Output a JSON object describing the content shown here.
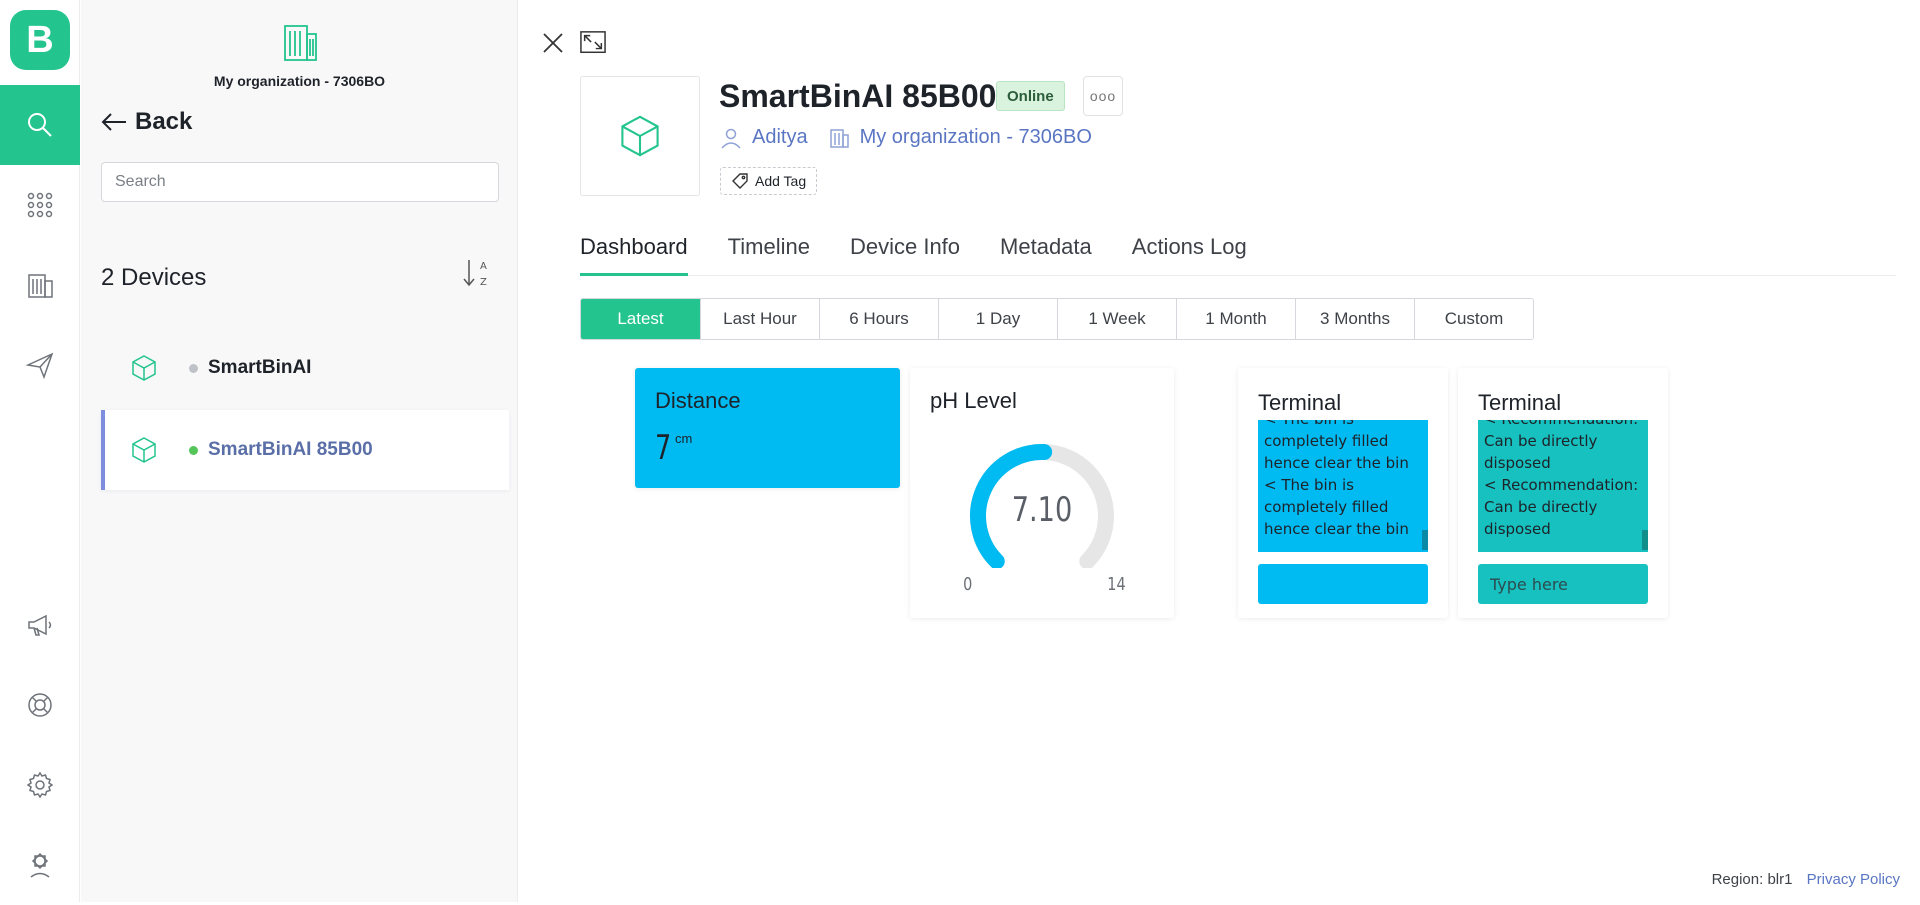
{
  "app": {
    "logo_letter": "B"
  },
  "rail": {
    "items": [
      "search-icon",
      "apps-grid-icon",
      "building-icon",
      "send-icon",
      "megaphone-icon",
      "lifebuoy-icon",
      "gear-icon",
      "user-badge-icon"
    ],
    "active": "search-icon"
  },
  "panel": {
    "org_name": "My organization - 7306BO",
    "back_label": "Back",
    "search_placeholder": "Search",
    "device_count": "2 Devices",
    "sort_icon": "sort-az-icon",
    "devices": [
      {
        "name": "SmartBinAI",
        "status": "offline",
        "status_color": "#bfc2c7"
      },
      {
        "name": "SmartBinAI 85B00",
        "status": "online",
        "status_color": "#53c559"
      }
    ]
  },
  "device": {
    "name": "SmartBinAI 85B00",
    "status_badge": "Online",
    "more_label": "ooo",
    "owner": "Aditya",
    "organization": "My organization - 7306BO",
    "add_tag_label": "Add Tag"
  },
  "tabs": [
    "Dashboard",
    "Timeline",
    "Device Info",
    "Metadata",
    "Actions Log"
  ],
  "active_tab": "Dashboard",
  "ranges": [
    "Latest",
    "Last Hour",
    "6 Hours",
    "1 Day",
    "1 Week",
    "1 Month",
    "3 Months",
    "Custom"
  ],
  "active_range": "Latest",
  "widgets": {
    "distance": {
      "title": "Distance",
      "value": "7",
      "unit": "cm",
      "bg_color": "#00baf2"
    },
    "ph": {
      "title": "pH Level",
      "value": "7.10",
      "numeric_value": 7.1,
      "min": "0",
      "max": "14",
      "color": "#00baf2",
      "track_color": "#e6e6e6"
    },
    "terminal1": {
      "title": "Terminal",
      "lines": [
        "< The bin is completely filled hence clear the bin",
        "< The bin is completely filled hence clear the bin"
      ],
      "input_value": "",
      "placeholder": "",
      "bg_color": "#00baf2"
    },
    "terminal2": {
      "title": "Terminal",
      "lines": [
        "< Recommendation: Can be directly disposed",
        "< Recommendation: Can be directly disposed"
      ],
      "input_value": "",
      "placeholder": "Type here",
      "bg_color": "#16c1bf"
    }
  },
  "footer": {
    "region": "Region: blr1",
    "privacy": "Privacy Policy"
  }
}
